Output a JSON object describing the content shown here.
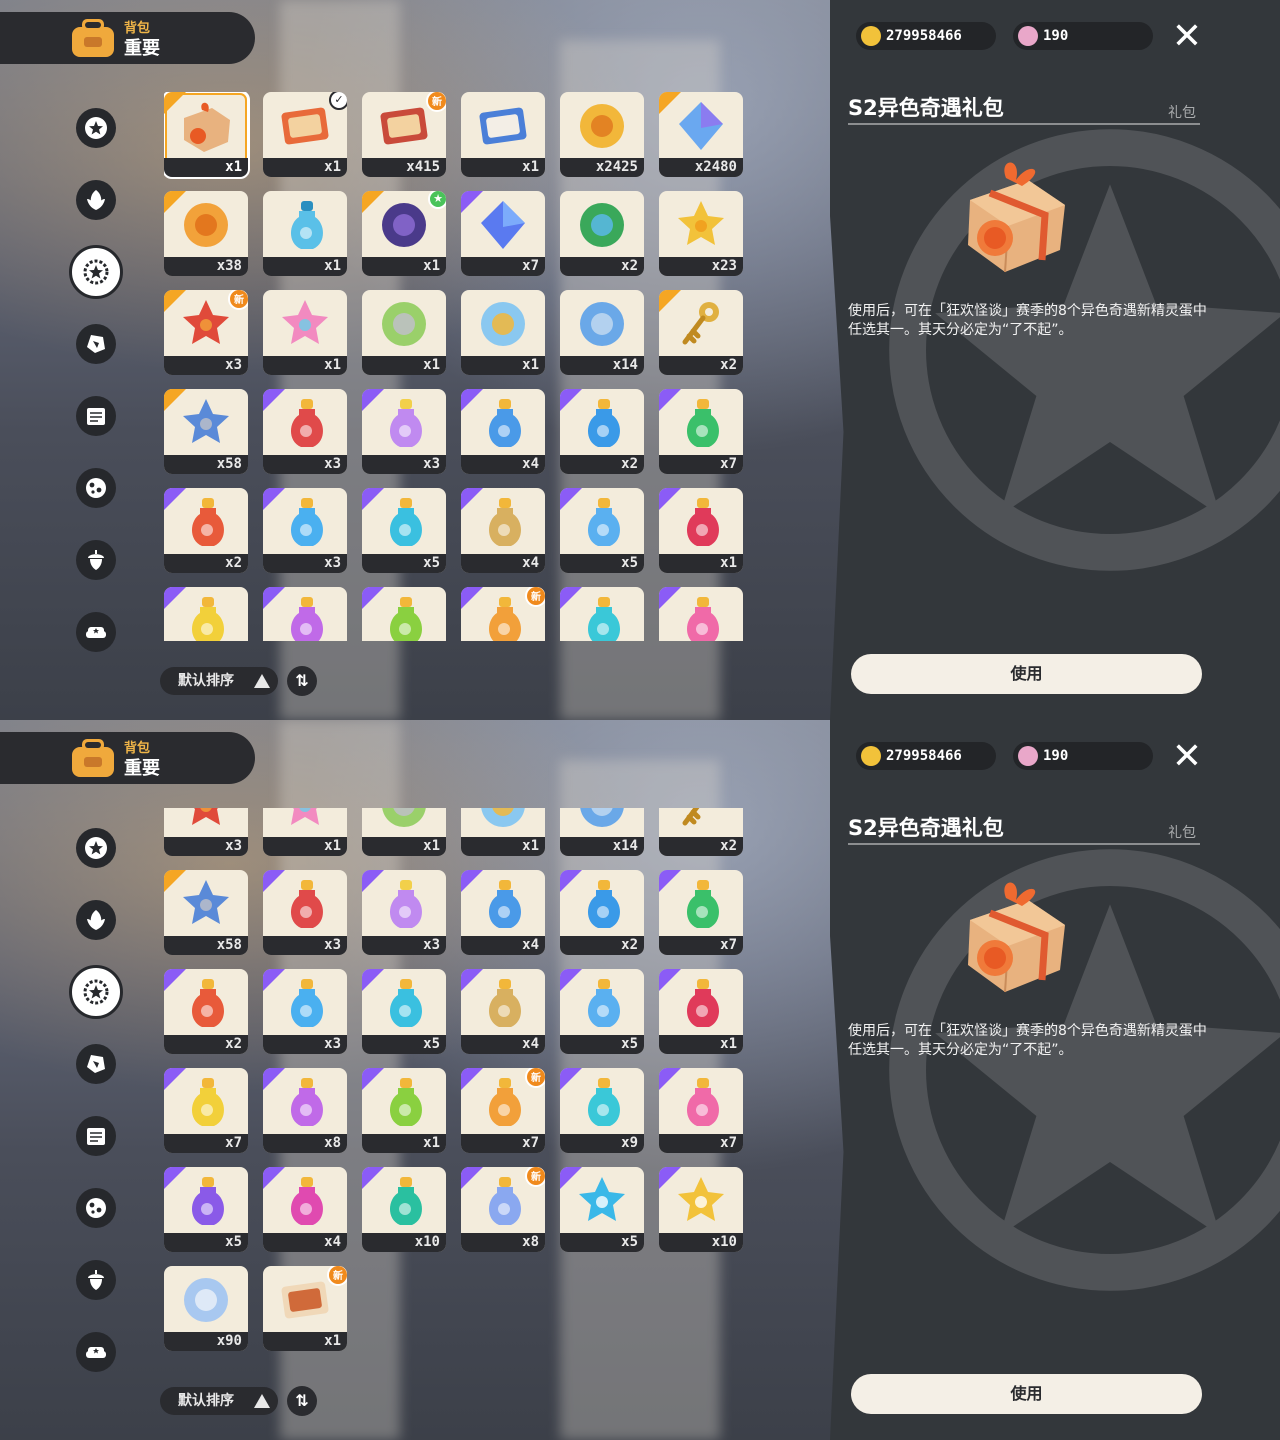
{
  "header": {
    "section_label": "背包",
    "tab_label": "重要"
  },
  "currency": {
    "coins": "279958466",
    "gems": "190"
  },
  "close_label": "✕",
  "sort": {
    "label": "默认排序",
    "toggle_label": "⇅"
  },
  "detail": {
    "title": "S2异色奇遇礼包",
    "category": "礼包",
    "description": "使用后，可在「狂欢怪谈」赛季的8个异色奇遇新精灵蛋中任选其一。其天分必定为“了不起”。",
    "use_label": "使用"
  },
  "side_nav": [
    "star-badge",
    "leaf",
    "star-gear",
    "crystal",
    "book",
    "egg",
    "acorn",
    "sofa"
  ],
  "screen1": {
    "items": [
      {
        "icon": "gift-box",
        "qty": "x1",
        "corner": "gold",
        "selected": true
      },
      {
        "icon": "ticket",
        "qty": "x1",
        "corner": "none",
        "badge": "check"
      },
      {
        "icon": "card",
        "qty": "x415",
        "corner": "none",
        "badge": "new"
      },
      {
        "icon": "pass",
        "qty": "x1",
        "corner": "none"
      },
      {
        "icon": "camera",
        "qty": "x2425",
        "corner": "none"
      },
      {
        "icon": "crystal",
        "qty": "x2480",
        "corner": "gold"
      },
      {
        "icon": "shell",
        "qty": "x38",
        "corner": "gold"
      },
      {
        "icon": "vial",
        "qty": "x1",
        "corner": "none"
      },
      {
        "icon": "pouch",
        "qty": "x1",
        "corner": "gold",
        "badge": "star"
      },
      {
        "icon": "gem-blue",
        "qty": "x7",
        "corner": "purple"
      },
      {
        "icon": "leaf-cap",
        "qty": "x2",
        "corner": "none"
      },
      {
        "icon": "star",
        "qty": "x23",
        "corner": "none"
      },
      {
        "icon": "red-orb",
        "qty": "x3",
        "corner": "gold",
        "badge": "new"
      },
      {
        "icon": "pink-star",
        "qty": "x1",
        "corner": "none"
      },
      {
        "icon": "mirror",
        "qty": "x1",
        "corner": "none"
      },
      {
        "icon": "gold-mirror",
        "qty": "x1",
        "corner": "none"
      },
      {
        "icon": "blue-orb",
        "qty": "x14",
        "corner": "none"
      },
      {
        "icon": "key",
        "qty": "x2",
        "corner": "gold"
      },
      {
        "icon": "wand",
        "qty": "x58",
        "corner": "gold"
      },
      {
        "icon": "red-potion",
        "qty": "x3",
        "corner": "purple"
      },
      {
        "icon": "rainbow-potion",
        "qty": "x3",
        "corner": "purple"
      },
      {
        "icon": "blue-potion",
        "qty": "x4",
        "corner": "purple"
      },
      {
        "icon": "blue-flask",
        "qty": "x2",
        "corner": "purple"
      },
      {
        "icon": "green-flask",
        "qty": "x7",
        "corner": "purple"
      },
      {
        "icon": "red-flask",
        "qty": "x2",
        "corner": "purple"
      },
      {
        "icon": "sky-flask",
        "qty": "x3",
        "corner": "purple"
      },
      {
        "icon": "cyan-flask",
        "qty": "x5",
        "corner": "purple"
      },
      {
        "icon": "tan-flask",
        "qty": "x4",
        "corner": "purple"
      },
      {
        "icon": "ice-flask",
        "qty": "x5",
        "corner": "purple"
      },
      {
        "icon": "crimson-flask",
        "qty": "x1",
        "corner": "purple"
      },
      {
        "icon": "yellow-flask",
        "qty": "",
        "corner": "purple"
      },
      {
        "icon": "violet-flask",
        "qty": "",
        "corner": "purple"
      },
      {
        "icon": "lime-flask",
        "qty": "",
        "corner": "purple"
      },
      {
        "icon": "orange-flask",
        "qty": "",
        "corner": "purple",
        "badge": "new"
      },
      {
        "icon": "teal-flask",
        "qty": "",
        "corner": "purple"
      },
      {
        "icon": "pink-flask",
        "qty": "",
        "corner": "purple"
      }
    ]
  },
  "screen2": {
    "items": [
      {
        "icon": "red-orb",
        "qty": "x3",
        "corner": "none"
      },
      {
        "icon": "pink-star",
        "qty": "x1",
        "corner": "none"
      },
      {
        "icon": "mirror",
        "qty": "x1",
        "corner": "none"
      },
      {
        "icon": "gold-mirror",
        "qty": "x1",
        "corner": "none"
      },
      {
        "icon": "blue-orb",
        "qty": "x14",
        "corner": "none"
      },
      {
        "icon": "key",
        "qty": "x2",
        "corner": "none"
      },
      {
        "icon": "wand",
        "qty": "x58",
        "corner": "gold"
      },
      {
        "icon": "red-potion",
        "qty": "x3",
        "corner": "purple"
      },
      {
        "icon": "rainbow-potion",
        "qty": "x3",
        "corner": "purple"
      },
      {
        "icon": "blue-potion",
        "qty": "x4",
        "corner": "purple"
      },
      {
        "icon": "blue-flask",
        "qty": "x2",
        "corner": "purple"
      },
      {
        "icon": "green-flask",
        "qty": "x7",
        "corner": "purple"
      },
      {
        "icon": "red-flask",
        "qty": "x2",
        "corner": "purple"
      },
      {
        "icon": "sky-flask",
        "qty": "x3",
        "corner": "purple"
      },
      {
        "icon": "cyan-flask",
        "qty": "x5",
        "corner": "purple"
      },
      {
        "icon": "tan-flask",
        "qty": "x4",
        "corner": "purple"
      },
      {
        "icon": "ice-flask",
        "qty": "x5",
        "corner": "purple"
      },
      {
        "icon": "crimson-flask",
        "qty": "x1",
        "corner": "purple"
      },
      {
        "icon": "yellow-flask",
        "qty": "x7",
        "corner": "purple"
      },
      {
        "icon": "violet-flask",
        "qty": "x8",
        "corner": "purple"
      },
      {
        "icon": "lime-flask",
        "qty": "x1",
        "corner": "purple"
      },
      {
        "icon": "orange-flask",
        "qty": "x7",
        "corner": "purple",
        "badge": "new"
      },
      {
        "icon": "teal-flask",
        "qty": "x9",
        "corner": "purple"
      },
      {
        "icon": "pink-flask",
        "qty": "x7",
        "corner": "purple"
      },
      {
        "icon": "purple-flask",
        "qty": "x5",
        "corner": "purple"
      },
      {
        "icon": "magenta-flask",
        "qty": "x4",
        "corner": "purple"
      },
      {
        "icon": "jade-flask",
        "qty": "x10",
        "corner": "purple"
      },
      {
        "icon": "swirl-flask",
        "qty": "x8",
        "corner": "purple",
        "badge": "new"
      },
      {
        "icon": "blue-star-ball",
        "qty": "x5",
        "corner": "purple"
      },
      {
        "icon": "gold-star-ball",
        "qty": "x10",
        "corner": "purple"
      },
      {
        "icon": "silver-coin",
        "qty": "x90",
        "corner": "none"
      },
      {
        "icon": "scroll",
        "qty": "x1",
        "corner": "none",
        "badge": "new"
      }
    ]
  }
}
